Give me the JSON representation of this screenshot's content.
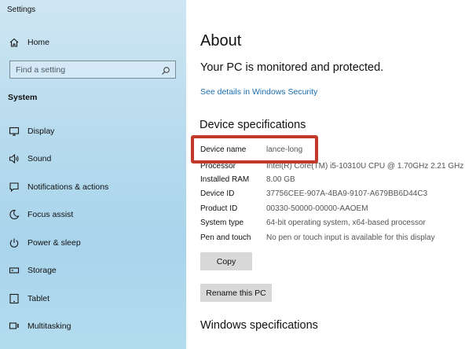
{
  "window": {
    "title": "Settings"
  },
  "sidebar": {
    "home_label": "Home",
    "search": {
      "placeholder": "Find a setting"
    },
    "section": "System",
    "items": [
      {
        "label": "Display",
        "icon": "display-icon"
      },
      {
        "label": "Sound",
        "icon": "sound-icon"
      },
      {
        "label": "Notifications & actions",
        "icon": "notifications-icon"
      },
      {
        "label": "Focus assist",
        "icon": "moon-icon"
      },
      {
        "label": "Power & sleep",
        "icon": "power-icon"
      },
      {
        "label": "Storage",
        "icon": "storage-icon"
      },
      {
        "label": "Tablet",
        "icon": "tablet-icon"
      },
      {
        "label": "Multitasking",
        "icon": "multitasking-icon"
      }
    ]
  },
  "main": {
    "title": "About",
    "protection_status": "Your PC is monitored and protected.",
    "security_link": "See details in Windows Security",
    "device_specs_heading": "Device specifications",
    "specs": [
      {
        "key": "Device name",
        "value": "lance-long"
      },
      {
        "key": "Processor",
        "value": "Intel(R) Core(TM) i5-10310U CPU @ 1.70GHz   2.21 GHz"
      },
      {
        "key": "Installed RAM",
        "value": "8.00 GB"
      },
      {
        "key": "Device ID",
        "value": "37756CEE-907A-4BA9-9107-A679BB6D44C3"
      },
      {
        "key": "Product ID",
        "value": "00330-50000-00000-AAOEM"
      },
      {
        "key": "System type",
        "value": "64-bit operating system, x64-based processor"
      },
      {
        "key": "Pen and touch",
        "value": "No pen or touch input is available for this display"
      }
    ],
    "copy_button": "Copy",
    "rename_button": "Rename this PC",
    "windows_specs_heading": "Windows specifications"
  },
  "colors": {
    "link": "#1a6dae",
    "highlight_border": "#c0392b",
    "button_bg": "#d8d8d8"
  }
}
